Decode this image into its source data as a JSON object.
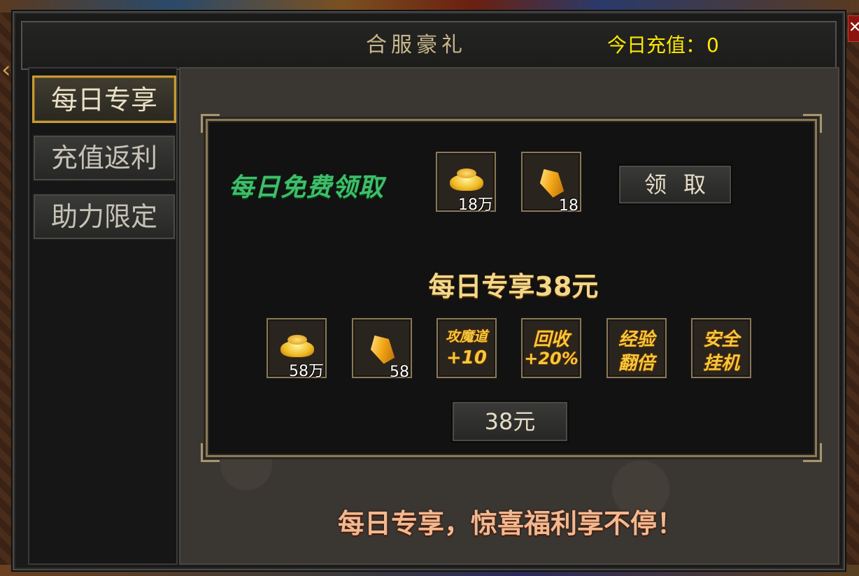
{
  "window": {
    "title": "合服豪礼",
    "recharge_label": "今日充值：",
    "recharge_value": "0",
    "close_symbol": "✕"
  },
  "sidebar": {
    "items": [
      {
        "label": "每日专享",
        "active": true
      },
      {
        "label": "充值返利",
        "active": false
      },
      {
        "label": "助力限定",
        "active": false
      }
    ]
  },
  "free_section": {
    "label": "每日免费领取",
    "rewards": [
      {
        "icon": "gold-ingot-icon",
        "qty": "18万"
      },
      {
        "icon": "gold-crystal-icon",
        "qty": "18"
      }
    ],
    "claim_button": "领取"
  },
  "offer": {
    "title": "每日专享38元",
    "rewards": [
      {
        "icon": "gold-ingot-icon",
        "qty": "58万"
      },
      {
        "icon": "gold-crystal-icon",
        "qty": "58"
      }
    ],
    "perks": [
      {
        "line1": "攻魔道",
        "line2": "+10"
      },
      {
        "line1": "回收",
        "line2": "+20%"
      },
      {
        "line1": "经验",
        "line2": "翻倍"
      },
      {
        "line1": "安全",
        "line2": "挂机"
      }
    ],
    "price_button": "38元"
  },
  "slogan": "每日专享，惊喜福利享不停！",
  "colors": {
    "accent_gold": "#c69a34",
    "recharge_yellow": "#ffe800",
    "free_green": "#3fbe6a"
  }
}
